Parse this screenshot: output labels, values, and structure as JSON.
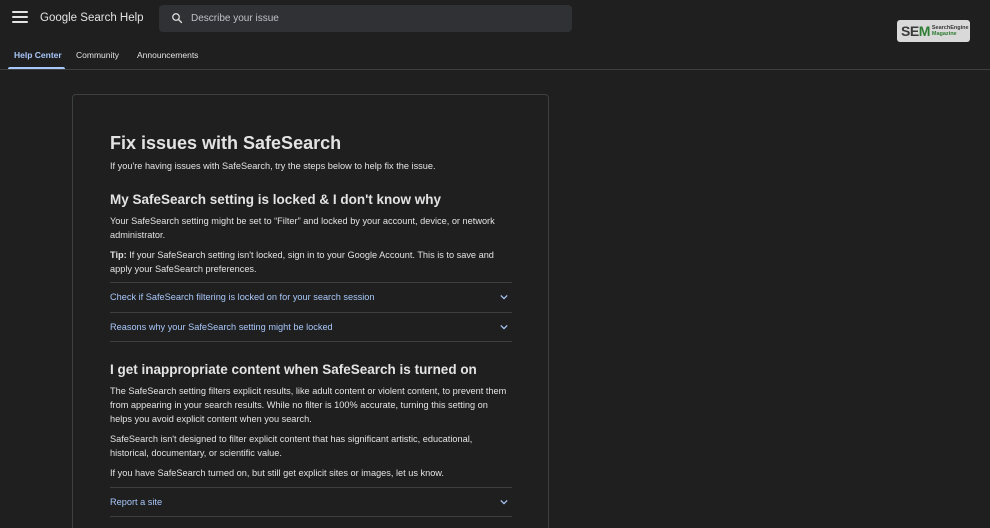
{
  "header": {
    "app_title": "Google Search Help",
    "search_placeholder": "Describe your issue"
  },
  "badge": {
    "logo_text_1": "SE",
    "logo_text_2": "M",
    "logo_sub_1": "SearchEngine",
    "logo_sub_2": "Magazine"
  },
  "tabs": [
    {
      "label": "Help Center",
      "active": true
    },
    {
      "label": "Community",
      "active": false
    },
    {
      "label": "Announcements",
      "active": false
    }
  ],
  "article": {
    "title": "Fix issues with SafeSearch",
    "intro": "If you're having issues with SafeSearch, try the steps below to help fix the issue.",
    "section1": {
      "heading": "My SafeSearch setting is locked & I don't know why",
      "body": "Your SafeSearch setting might be set to “Filter” and locked by your account, device, or network administrator.",
      "tip_label": "Tip:",
      "tip_text": " If your SafeSearch setting isn't locked, sign in to your Google Account. This is to save and apply your SafeSearch preferences.",
      "accordions": [
        "Check if SafeSearch filtering is locked on for your search session",
        "Reasons why your SafeSearch setting might be locked"
      ]
    },
    "section2": {
      "heading": "I get inappropriate content when SafeSearch is turned on",
      "body1": "The SafeSearch setting filters explicit results, like adult content or violent content, to prevent them from appearing in your search results. While no filter is 100% accurate, turning this setting on helps you avoid explicit content when you search.",
      "body2": "SafeSearch isn't designed to filter explicit content that has significant artistic, educational, historical, documentary, or scientific value.",
      "body3": "If you have SafeSearch turned on, but still get explicit sites or images, let us know.",
      "accordions": [
        "Report a site"
      ]
    }
  },
  "colors": {
    "background": "#1f1f1f",
    "link": "#a8c7fa",
    "divider": "#3c4043"
  }
}
